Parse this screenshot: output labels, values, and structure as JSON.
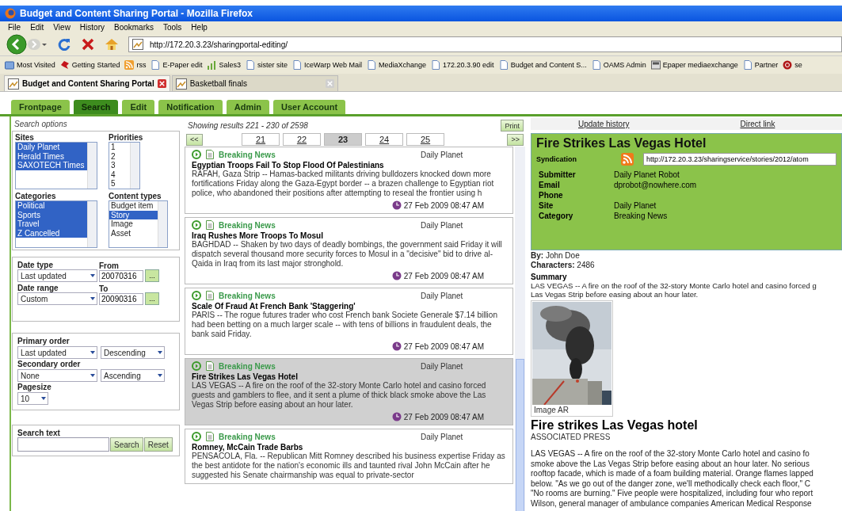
{
  "window": {
    "title": "Budget and Content Sharing Portal - Mozilla Firefox"
  },
  "menu": [
    "File",
    "Edit",
    "View",
    "History",
    "Bookmarks",
    "Tools",
    "Help"
  ],
  "address": {
    "url": "http://172.20.3.23/sharingportal-editing/"
  },
  "bookmarks": [
    {
      "label": "Most Visited",
      "kind": "folder"
    },
    {
      "label": "Getting Started",
      "kind": "bird"
    },
    {
      "label": "rss",
      "kind": "rss"
    },
    {
      "label": "E-Paper edit",
      "kind": "page"
    },
    {
      "label": "Sales3",
      "kind": "bars"
    },
    {
      "label": "sister site",
      "kind": "page"
    },
    {
      "label": "IceWarp Web Mail",
      "kind": "page"
    },
    {
      "label": "MediaXchange",
      "kind": "page"
    },
    {
      "label": "172.20.3.90 edit",
      "kind": "page"
    },
    {
      "label": "Budget and Content S...",
      "kind": "page"
    },
    {
      "label": "OAMS Admin",
      "kind": "page"
    },
    {
      "label": "Epaper mediaexchange",
      "kind": "tray"
    },
    {
      "label": "Partner",
      "kind": "page"
    },
    {
      "label": "se",
      "kind": "badge"
    }
  ],
  "browser_tabs": [
    {
      "label": "Budget and Content Sharing Portal",
      "selected": true
    },
    {
      "label": "Basketball finals",
      "selected": false
    }
  ],
  "app_tabs": [
    {
      "label": "Frontpage",
      "selected": false
    },
    {
      "label": "Search",
      "selected": true
    },
    {
      "label": "Edit",
      "selected": false
    },
    {
      "label": "Notification",
      "selected": false
    },
    {
      "label": "Admin",
      "selected": false
    },
    {
      "label": "User Account",
      "selected": false
    }
  ],
  "search_options": {
    "title": "Search options",
    "lists": [
      {
        "label": "Sites",
        "options": [
          {
            "label": "Daily Planet",
            "selected": true
          },
          {
            "label": "Herald Times",
            "selected": true
          },
          {
            "label": "SAXOTECH Times",
            "selected": true
          }
        ]
      },
      {
        "label": "Priorities",
        "options": [
          {
            "label": "1",
            "selected": false
          },
          {
            "label": "2",
            "selected": false
          },
          {
            "label": "3",
            "selected": false
          },
          {
            "label": "4",
            "selected": false
          },
          {
            "label": "5",
            "selected": false
          }
        ]
      },
      {
        "label": "Categories",
        "options": [
          {
            "label": "Political",
            "selected": true
          },
          {
            "label": "Sports",
            "selected": true
          },
          {
            "label": "Travel",
            "selected": true
          },
          {
            "label": "Z Cancelled",
            "selected": true
          }
        ]
      },
      {
        "label": "Content types",
        "options": [
          {
            "label": "Budget item",
            "selected": false
          },
          {
            "label": "Story",
            "selected": true
          },
          {
            "label": "Image",
            "selected": false
          },
          {
            "label": "Asset",
            "selected": false
          }
        ]
      }
    ],
    "date_rows": [
      {
        "label": "Date type",
        "value": "Last updated",
        "date_label": "From",
        "date": "20070316",
        "button": "..."
      },
      {
        "label": "Date range",
        "value": "Custom",
        "date_label": "To",
        "date": "20090316",
        "button": "..."
      }
    ],
    "orders": [
      {
        "label": "Primary order",
        "value": "Last updated",
        "direction": "Descending"
      },
      {
        "label": "Secondary order",
        "value": "None",
        "direction": "Ascending"
      }
    ],
    "pagesize": {
      "label": "Pagesize",
      "value": "10"
    },
    "search_text": {
      "label": "Search text"
    },
    "buttons": [
      "Search",
      "Reset"
    ]
  },
  "results": {
    "summary": "Showing results 221 - 230 of 2598",
    "print": "Print",
    "prev": "<<",
    "next": ">>",
    "pages": [
      {
        "label": "21",
        "selected": false
      },
      {
        "label": "22",
        "selected": false
      },
      {
        "label": "23",
        "selected": true
      },
      {
        "label": "24",
        "selected": false
      },
      {
        "label": "25",
        "selected": false
      }
    ],
    "items": [
      {
        "category": "Breaking News",
        "source": "Daily Planet",
        "title": "Egyptian Troops Fail To Stop Flood Of Palestinians",
        "snippet": "RAFAH, Gaza Strip -- Hamas-backed militants driving bulldozers knocked down more fortifications Friday along the Gaza-Egypt border -- a brazen challenge to Egyptian riot police, who abandoned their positions after attempting to reseal the frontier using h",
        "time": "27 Feb 2009 08:47 AM",
        "selected": false
      },
      {
        "category": "Breaking News",
        "source": "Daily Planet",
        "title": "Iraq Rushes More Troops To Mosul",
        "snippet": "BAGHDAD -- Shaken by two days of deadly bombings, the government said Friday it will dispatch several thousand more security forces to Mosul in a \"decisive\" bid to drive al-Qaida in Iraq from its last major stronghold.",
        "time": "27 Feb 2009 08:47 AM",
        "selected": false
      },
      {
        "category": "Breaking News",
        "source": "Daily Planet",
        "title": "Scale Of Fraud At French Bank 'Staggering'",
        "snippet": "PARIS -- The rogue futures trader who cost French bank Societe Generale $7.14 billion had been betting on a much larger scale -- with tens of billions in fraudulent deals, the bank said Friday.",
        "time": "27 Feb 2009 08:47 AM",
        "selected": false
      },
      {
        "category": "Breaking News",
        "source": "Daily Planet",
        "title": "Fire Strikes Las Vegas Hotel",
        "snippet": "LAS VEGAS -- A fire on the roof of the 32-story Monte Carlo hotel and casino forced guests and gamblers to flee, and it sent a plume of thick black smoke above the Las Vegas Strip before easing about an hour later.",
        "time": "27 Feb 2009 08:47 AM",
        "selected": true
      },
      {
        "category": "Breaking News",
        "source": "Daily Planet",
        "title": "Romney, McCain Trade Barbs",
        "snippet": "PENSACOLA, Fla. -- Republican Mitt Romney described his business expertise Friday as the best antidote for the nation's economic ills and taunted rival John McCain after he suggested his Senate chairmanship was equal to private-sector",
        "selected": false
      }
    ]
  },
  "detail": {
    "links": [
      "Update history",
      "Direct link"
    ],
    "title": "Fire Strikes Las Vegas Hotel",
    "syndication": {
      "label": "Syndication",
      "url": "http://172.20.3.23/sharingservice/stories/2012/atom"
    },
    "fields": [
      {
        "label": "Submitter",
        "value": "Daily Planet Robot"
      },
      {
        "label": "Email",
        "value": "dprobot@nowhere.com"
      },
      {
        "label": "Phone"
      },
      {
        "label": "Site",
        "value": "Daily Planet"
      },
      {
        "label": "Category",
        "value": "Breaking News"
      }
    ],
    "by": "**By:** John Doe",
    "characters": "**Characters:** 2486",
    "summary_label": "Summary",
    "summary_lines": [
      "LAS VEGAS -- A fire on the roof of the 32-story Monte Carlo hotel and casino forced g",
      "Las Vegas Strip before easing about an hour later."
    ],
    "image": {
      "kind": "picture",
      "caption": "Image AR"
    },
    "headline": "Fire strikes Las Vegas hotel",
    "byline": "ASSOCIATED PRESS",
    "body_lines": [
      "LAS VEGAS -- A fire on the roof of the 32-story Monte Carlo hotel and casino fo",
      "smoke above the Las Vegas Strip before easing about an hour later. No serious",
      "rooftop facade, which is made of a foam building material. Orange flames lapped",
      "below. \"As we go out of the danger zone, we'll methodically check each floor,\" C",
      "\"No rooms are burning.\" Five people were hospitalized, including four who report",
      "Wilson, general manager of ambulance companies American Medical Response"
    ]
  }
}
